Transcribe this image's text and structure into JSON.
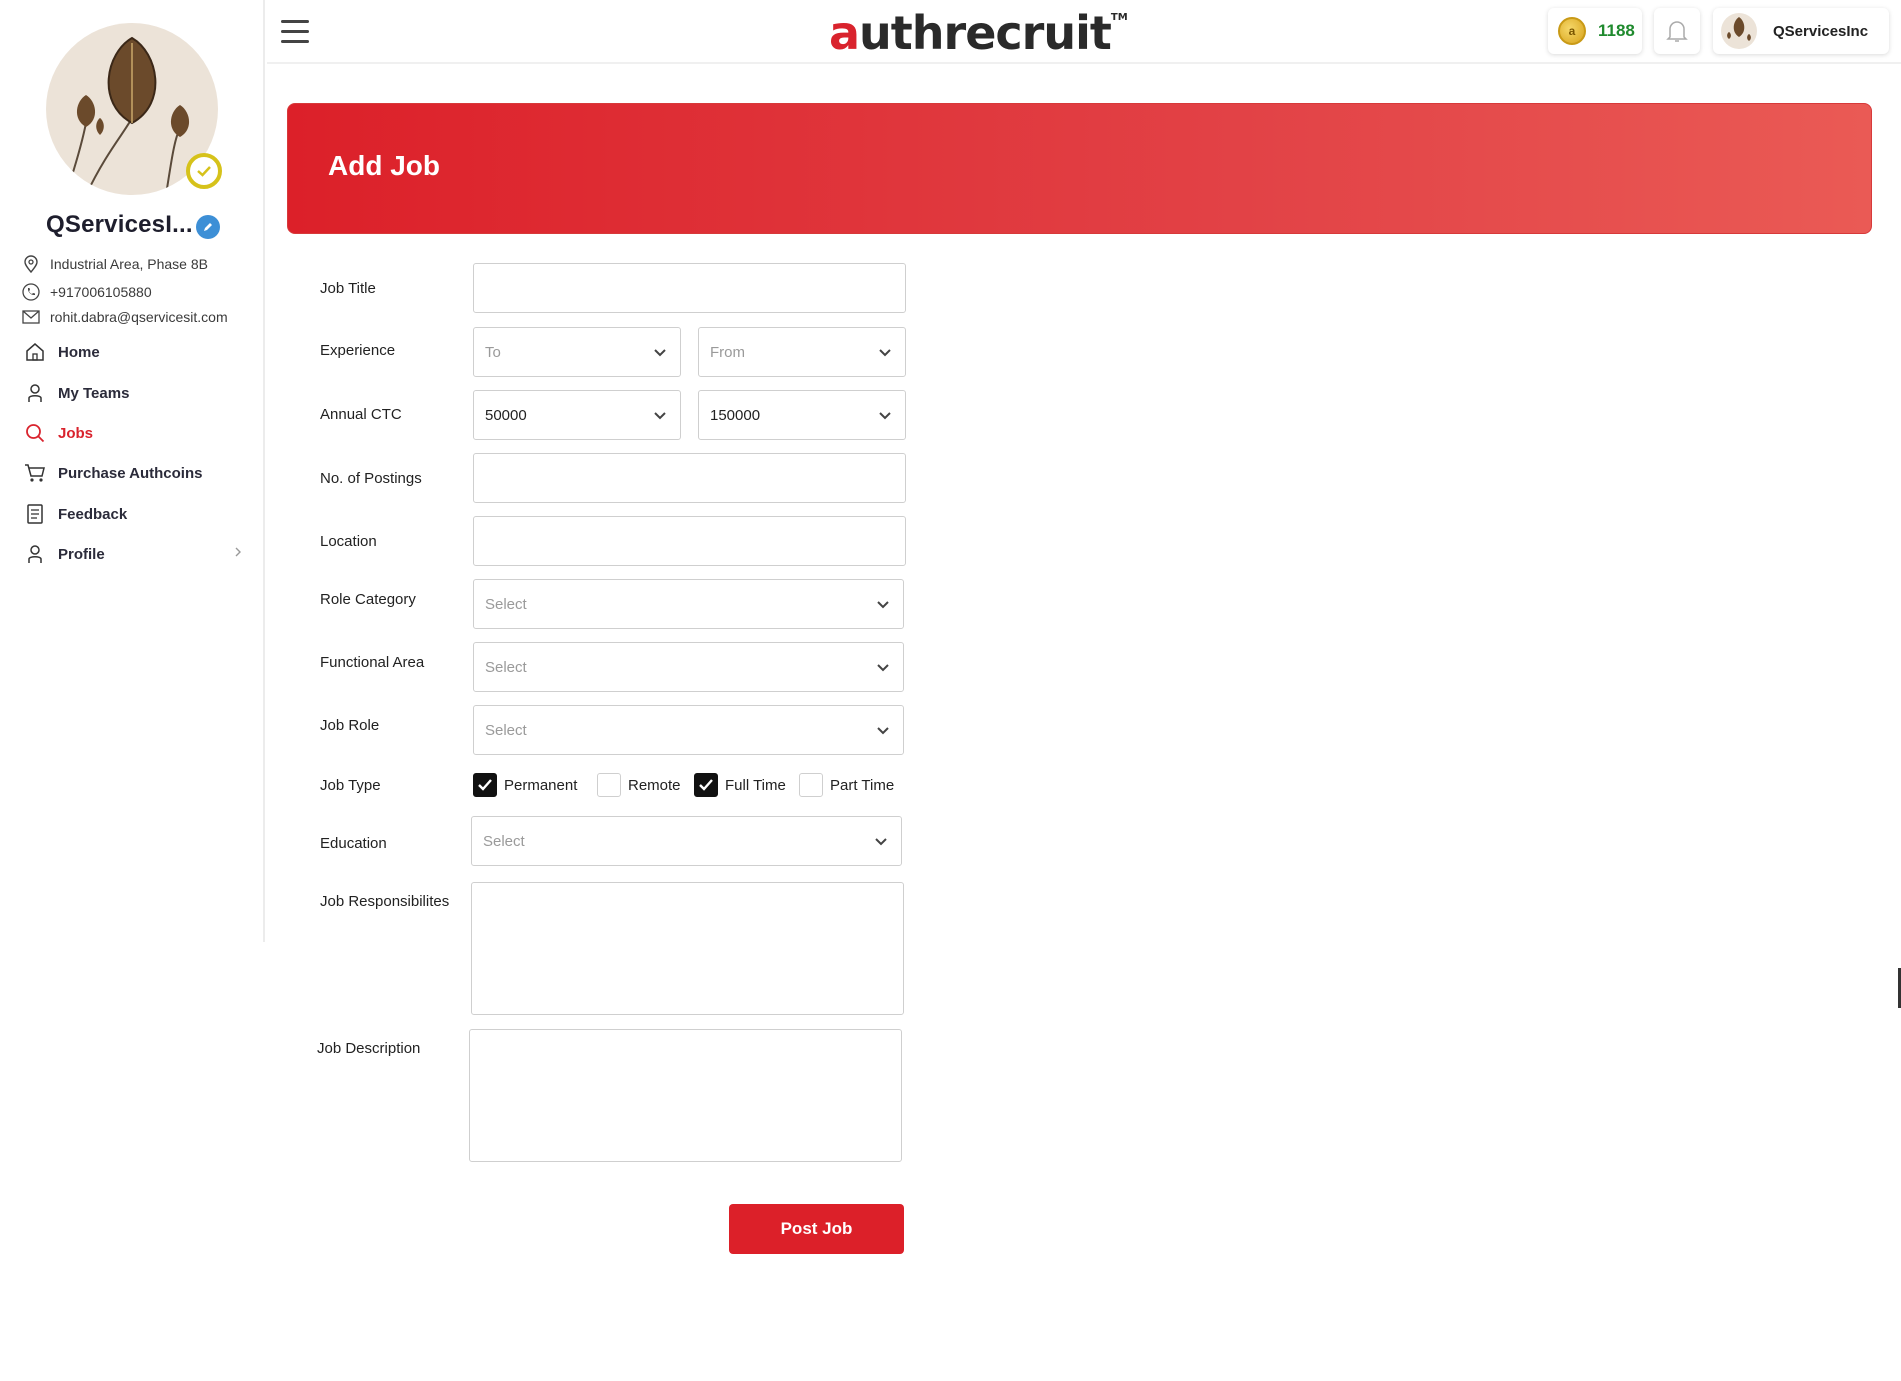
{
  "sidebar": {
    "org_name": "QServicesI...",
    "address": "Industrial Area, Phase 8B",
    "phone": "+917006105880",
    "email": "rohit.dabra@qservicesit.com",
    "nav": [
      {
        "label": "Home",
        "icon": "home-icon"
      },
      {
        "label": "My Teams",
        "icon": "user-icon"
      },
      {
        "label": "Jobs",
        "icon": "search-icon",
        "active": true
      },
      {
        "label": "Purchase Authcoins",
        "icon": "cart-icon"
      },
      {
        "label": "Feedback",
        "icon": "document-icon"
      },
      {
        "label": "Profile",
        "icon": "user-icon"
      }
    ]
  },
  "header": {
    "logo_prefix": "a",
    "logo_rest": "uthrecruit",
    "logo_tm": "TM",
    "coin_count": "1188",
    "user_name": "QServicesInc"
  },
  "banner": {
    "title": "Add Job"
  },
  "form": {
    "job_title_label": "Job Title",
    "experience_label": "Experience",
    "experience_to": "To",
    "experience_from": "From",
    "ctc_label": "Annual CTC",
    "ctc_min": "50000",
    "ctc_max": "150000",
    "postings_label": "No. of Postings",
    "location_label": "Location",
    "role_category_label": "Role Category",
    "role_category_value": "Select",
    "functional_area_label": "Functional Area",
    "functional_area_value": "Select",
    "job_role_label": "Job Role",
    "job_role_value": "Select",
    "job_type_label": "Job Type",
    "job_types": [
      {
        "label": "Permanent",
        "checked": true
      },
      {
        "label": "Remote",
        "checked": false
      },
      {
        "label": "Full Time",
        "checked": true
      },
      {
        "label": "Part Time",
        "checked": false
      }
    ],
    "education_label": "Education",
    "education_value": "Select",
    "responsibilities_label": "Job Responsibilites",
    "description_label": "Job Description",
    "submit_label": "Post Job"
  },
  "colors": {
    "accent": "#dc2029",
    "coin_text": "#1f8a2e",
    "edit_badge": "#3d8fd6",
    "verified": "#d6c21a"
  }
}
